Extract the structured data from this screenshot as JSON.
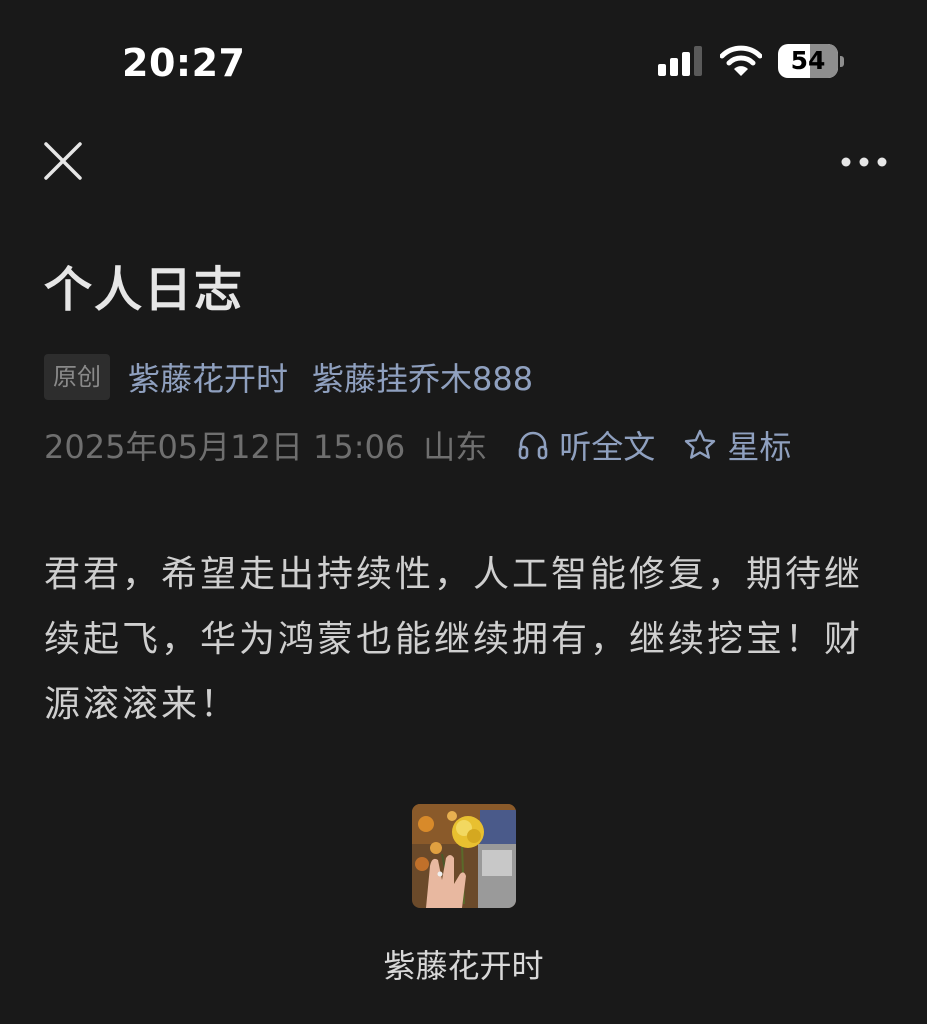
{
  "status_bar": {
    "time": "20:27",
    "battery_level": "54",
    "battery_fraction": 0.54,
    "signal_bars_active": 3,
    "signal_bars_total": 4
  },
  "nav": {
    "close_icon": "close-icon",
    "more_icon": "more-horizontal-icon"
  },
  "article": {
    "title": "个人日志",
    "original_badge": "原创",
    "account_name": "紫藤花开时",
    "author_name": "紫藤挂乔木888",
    "date": "2025年05月12日 15:06",
    "region": "山东",
    "listen_label": "听全文",
    "star_label": "星标",
    "body": "君君，希望走出持续性，人工智能修复，期待继续起飞，华为鸿蒙也能继续拥有，继续挖宝！财源滚滚来！"
  },
  "author_card": {
    "name": "紫藤花开时"
  },
  "colors": {
    "background": "#191919",
    "link": "#8fa0bf",
    "muted": "#6f6f6f"
  }
}
